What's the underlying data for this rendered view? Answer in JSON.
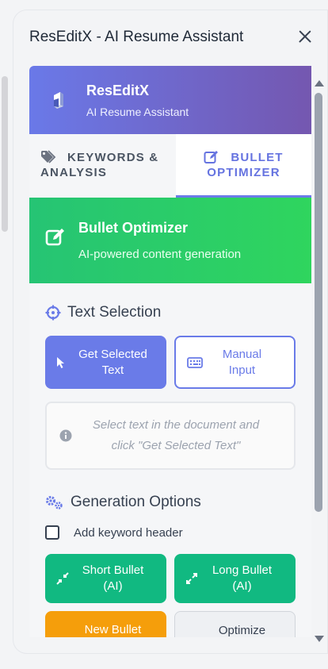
{
  "window": {
    "title": "ResEditX - AI Resume Assistant"
  },
  "brand": {
    "name": "ResEditX",
    "subtitle": "AI Resume Assistant"
  },
  "tabs": [
    {
      "line1": "KEYWORDS &",
      "line2": "ANALYSIS",
      "active": false
    },
    {
      "line1": "BULLET",
      "line2": "OPTIMIZER",
      "active": true
    }
  ],
  "banner": {
    "title": "Bullet Optimizer",
    "subtitle": "AI-powered content generation"
  },
  "text_selection": {
    "title": "Text Selection",
    "get_selected": {
      "line1": "Get Selected",
      "line2": "Text"
    },
    "manual_input": {
      "line1": "Manual",
      "line2": "Input"
    },
    "hint": {
      "line1": "Select text in the document and",
      "line2": "click \"Get Selected Text\""
    }
  },
  "generation": {
    "title": "Generation Options",
    "checkbox_label": "Add keyword header",
    "short_bullet": {
      "line1": "Short Bullet",
      "line2": "(AI)"
    },
    "long_bullet": {
      "line1": "Long Bullet",
      "line2": "(AI)"
    },
    "new_bullet": {
      "line1": "New Bullet",
      "line2": ""
    },
    "optimize": {
      "line1": "Optimize",
      "line2": ""
    }
  },
  "colors": {
    "primary": "#6a7be8",
    "green": "#11b981",
    "orange": "#f59e0b",
    "brand_gradient_end": "#7457b0"
  }
}
